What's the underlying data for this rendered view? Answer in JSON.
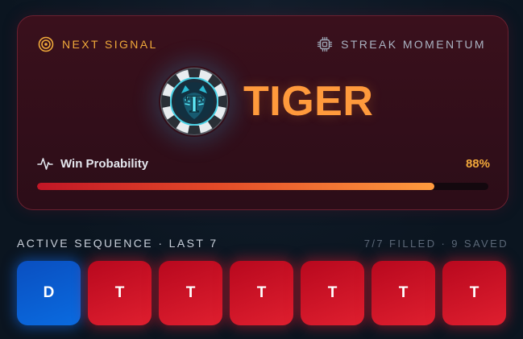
{
  "signal": {
    "label": "NEXT SIGNAL",
    "label_icon": "target-icon",
    "right_label": "STREAK MOMENTUM",
    "right_icon": "chip-icon",
    "pick": "TIGER",
    "token_letter": "T",
    "token_icon": "tiger-token-icon",
    "probability_label": "Win Probability",
    "probability_icon": "pulse-icon",
    "probability_value": "88%",
    "probability_fraction": 0.88
  },
  "sequence": {
    "title": "ACTIVE SEQUENCE · LAST 7",
    "meta": "7/7 FILLED · 9 SAVED",
    "tiles": [
      {
        "label": "D",
        "kind": "dragon"
      },
      {
        "label": "T",
        "kind": "tiger"
      },
      {
        "label": "T",
        "kind": "tiger"
      },
      {
        "label": "T",
        "kind": "tiger"
      },
      {
        "label": "T",
        "kind": "tiger"
      },
      {
        "label": "T",
        "kind": "tiger"
      },
      {
        "label": "T",
        "kind": "tiger"
      }
    ]
  },
  "colors": {
    "accent_gold": "#f0a93a",
    "pick_orange": "#ff9a3c",
    "dragon_blue": "#0a6be0",
    "tiger_red": "#df1f2f",
    "card_bg": "#2c0d18"
  }
}
